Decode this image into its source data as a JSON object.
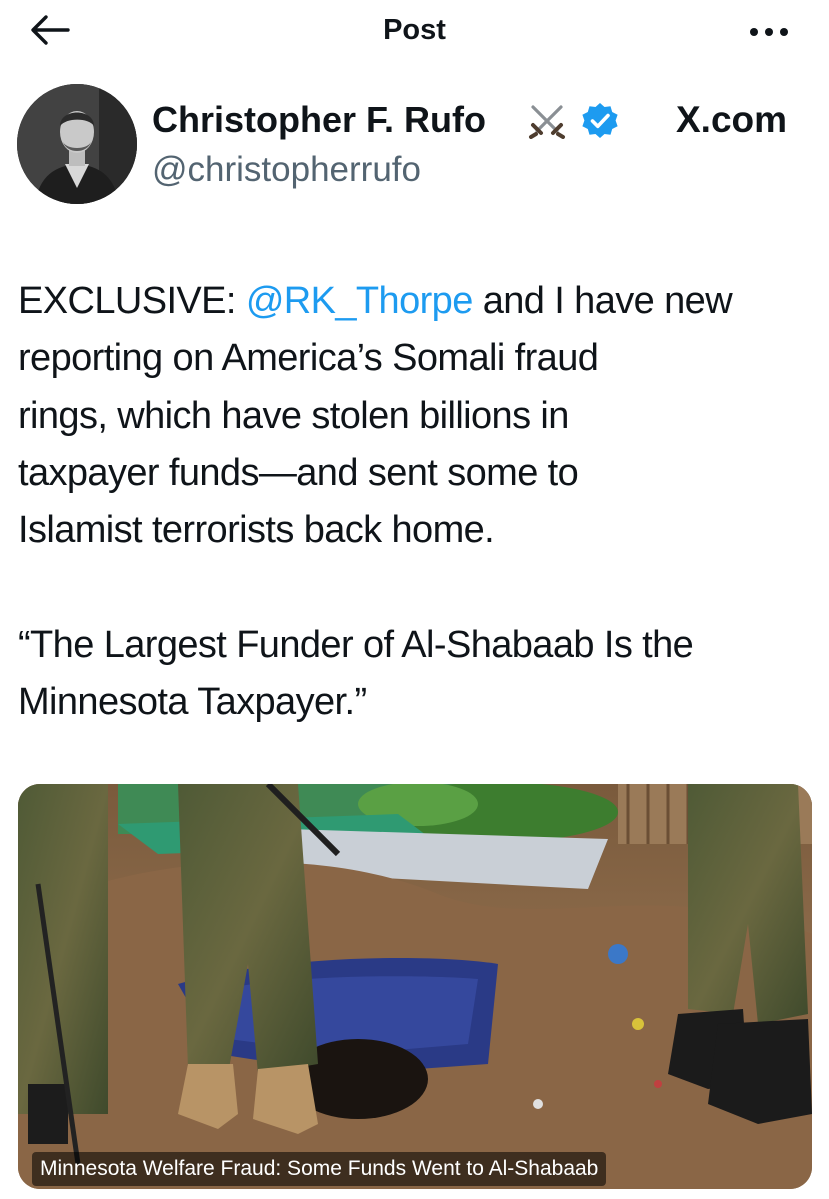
{
  "header": {
    "title": "Post",
    "back_icon": "arrow-left-icon",
    "more_icon": "more-horizontal-icon"
  },
  "author": {
    "name": "Christopher F. Rufo",
    "handle": "@christopherrufo",
    "badge_emoji": "crossed-swords-icon",
    "verified": true,
    "verified_color": "#1d9bf0"
  },
  "source": "X.com",
  "tweet": {
    "lines": [
      {
        "before": "EXCLUSIVE: ",
        "mention": "@RK_Thorpe",
        "after": " and I have new"
      },
      {
        "text": "reporting on America’s Somali fraud"
      },
      {
        "text": "rings, which have stolen billions in"
      },
      {
        "text": "taxpayer funds—and sent some to"
      },
      {
        "text": "Islamist terrorists back home."
      }
    ],
    "quote_lines": [
      "“The Largest Funder of Al-Shabaab Is the",
      "Minnesota Taxpayer.”"
    ]
  },
  "media": {
    "caption": "Minnesota Welfare Fraud: Some Funds Went to Al-Shabaab"
  },
  "colors": {
    "accent": "#1d9bf0",
    "secondary_text": "#536471",
    "text": "#0f1419"
  }
}
